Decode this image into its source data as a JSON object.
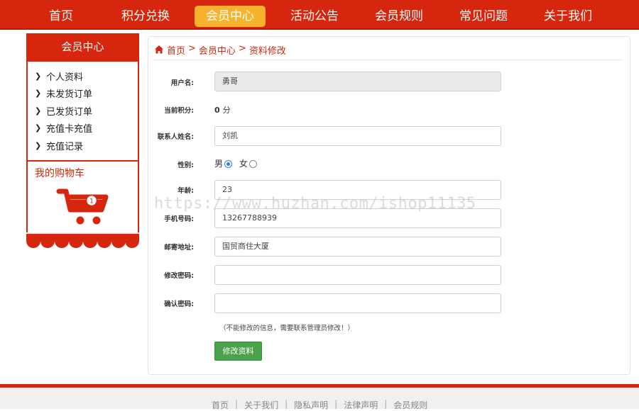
{
  "nav": {
    "items": [
      {
        "label": "首页"
      },
      {
        "label": "积分兑换"
      },
      {
        "label": "会员中心",
        "active": true
      },
      {
        "label": "活动公告"
      },
      {
        "label": "会员规则"
      },
      {
        "label": "常见问题"
      },
      {
        "label": "关于我们"
      }
    ]
  },
  "sidebar": {
    "title": "会员中心",
    "items": [
      {
        "label": "个人资料"
      },
      {
        "label": "未发货订单"
      },
      {
        "label": "已发货订单"
      },
      {
        "label": "充值卡充值"
      },
      {
        "label": "充值记录"
      }
    ],
    "cart_title": "我的购物车",
    "cart_count": "1"
  },
  "breadcrumb": {
    "home": "首页",
    "sep1": ">",
    "member": "会员中心",
    "sep2": ">",
    "current": "资料修改"
  },
  "form": {
    "username_label": "用户名:",
    "username_value": "勇哥",
    "points_label": "当前积分:",
    "points_value": "0",
    "points_unit": "分",
    "contact_label": "联系人姓名:",
    "contact_value": "刘凯",
    "gender_label": "性别:",
    "gender_male": "男",
    "gender_female": "女",
    "age_label": "年龄:",
    "age_value": "23",
    "phone_label": "手机号码:",
    "phone_value": "13267788939",
    "address_label": "邮寄地址:",
    "address_value": "国贸商住大厦",
    "password_label": "修改密码:",
    "password_value": "",
    "confirm_label": "确认密码:",
    "confirm_value": "",
    "note": "（不能修改的信息，需要联系管理员修改！）",
    "submit_label": "修改资料"
  },
  "watermark": "https://www.huzhan.com/ishop11135",
  "footer": {
    "links": [
      {
        "label": "首页"
      },
      {
        "label": "关于我们"
      },
      {
        "label": "隐私声明"
      },
      {
        "label": "法律声明"
      },
      {
        "label": "会员规则"
      }
    ],
    "sep": "|"
  },
  "colors": {
    "brand_red": "#d6260d",
    "active_tab": "#f7b32e",
    "submit_green": "#4aa34a",
    "radio_blue": "#2b7de9"
  }
}
